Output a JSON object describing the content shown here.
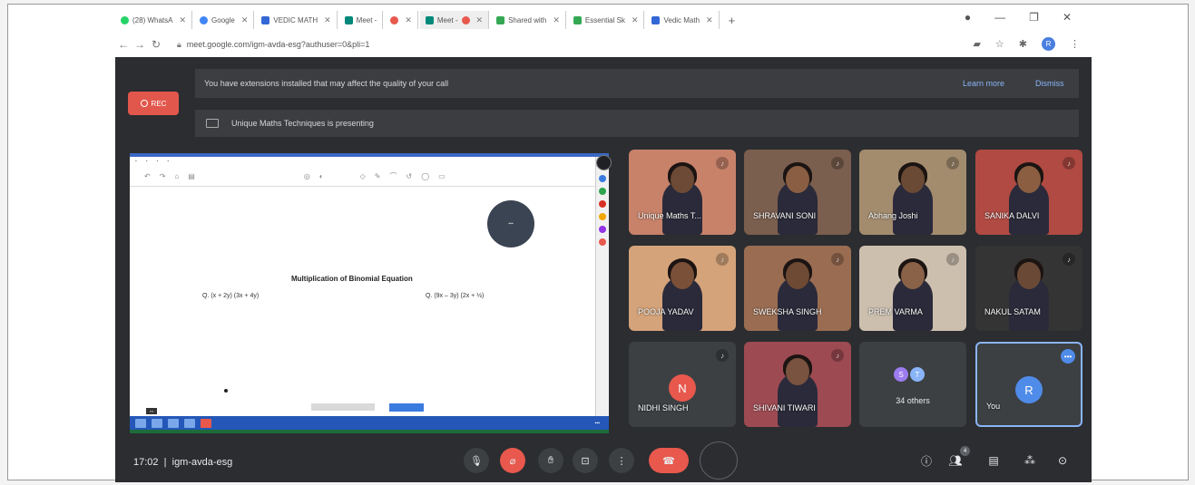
{
  "browser": {
    "tabs": [
      {
        "label": "(28) WhatsA",
        "color": "#25d366"
      },
      {
        "label": "Google",
        "color": "#4285f4"
      },
      {
        "label": "VEDIC MATH",
        "color": "#3367d6"
      },
      {
        "label": "Meet -",
        "color": "#00897b"
      },
      {
        "label": "",
        "color": "#e8584d"
      },
      {
        "label": "Meet -",
        "color": "#00897b"
      },
      {
        "label": "Shared with",
        "color": "#34a853"
      },
      {
        "label": "Essential Sk",
        "color": "#34a853"
      },
      {
        "label": "Vedic Math",
        "color": "#3367d6"
      }
    ],
    "url": "meet.google.com/igm-avda-esg?authuser=0&pli=1",
    "profile_initial": "R"
  },
  "meet": {
    "extension_notice": "You have extensions installed that may affect the quality of your call",
    "learn_more": "Learn more",
    "dismiss": "Dismiss",
    "rec_label": "REC",
    "presenting_text": "Unique Maths Techniques is presenting",
    "shared_doc": {
      "title": "Multiplication of Binomial Equation",
      "q1": "Q. (x + 2y) (3x + 4y)",
      "q2": "Q. (9x – 3y) (2x + ½)"
    },
    "participants": [
      {
        "name": "Unique Maths T...",
        "bg": "#c8826a",
        "skin": "#6d4a36"
      },
      {
        "name": "SHRAVANI SONI",
        "bg": "#7a5e4e",
        "skin": "#8a5e42"
      },
      {
        "name": "Abhang Joshi",
        "bg": "#a38c6e",
        "skin": "#6a4a34"
      },
      {
        "name": "SANIKA DALVI",
        "bg": "#b04a43",
        "skin": "#8b5e42"
      },
      {
        "name": "POOJA YADAV",
        "bg": "#d4a37a",
        "skin": "#7a5038"
      },
      {
        "name": "SWEKSHA SINGH",
        "bg": "#9a6d52",
        "skin": "#6e4a34"
      },
      {
        "name": "PREM VARMA",
        "bg": "#cdbfae",
        "skin": "#8a6248"
      },
      {
        "name": "NAKUL SATAM",
        "bg": "#343434",
        "skin": "#6a4a36"
      },
      {
        "name": "SHIVANI TIWARI",
        "bg": "#9d4a52",
        "skin": "#7a5240"
      }
    ],
    "nidhi": {
      "name": "NIDHI SINGH",
      "initial": "N",
      "color": "#e8584d"
    },
    "others": {
      "label": "34 others",
      "a": "S",
      "b": "T",
      "a_color": "#9c7cf0",
      "b_color": "#8ab4f8"
    },
    "you": {
      "label": "You",
      "initial": "R",
      "color": "#4f8be8"
    },
    "meeting_time": "17:02",
    "meeting_code": "igm-avda-esg",
    "participant_badge": "4"
  }
}
